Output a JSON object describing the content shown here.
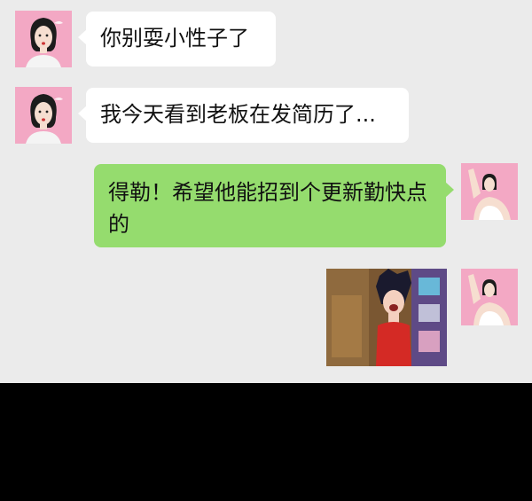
{
  "colors": {
    "chat_background": "#ebebeb",
    "incoming_bubble": "#ffffff",
    "outgoing_bubble": "#95dc6e",
    "avatar_background": "#f3a8c4"
  },
  "messages": [
    {
      "direction": "incoming",
      "avatar": "woman-portrait-avatar",
      "text": "你别耍小性子了"
    },
    {
      "direction": "incoming",
      "avatar": "woman-portrait-avatar",
      "text": "我今天看到老板在发简历了..."
    },
    {
      "direction": "outgoing",
      "avatar": "woman-raised-arm-avatar",
      "text": "得勒！希望他能招到个更新勤快点的"
    },
    {
      "direction": "outgoing",
      "avatar": "woman-raised-arm-avatar",
      "type": "image",
      "image": "laughing-woman-red-dress-sticker"
    }
  ]
}
